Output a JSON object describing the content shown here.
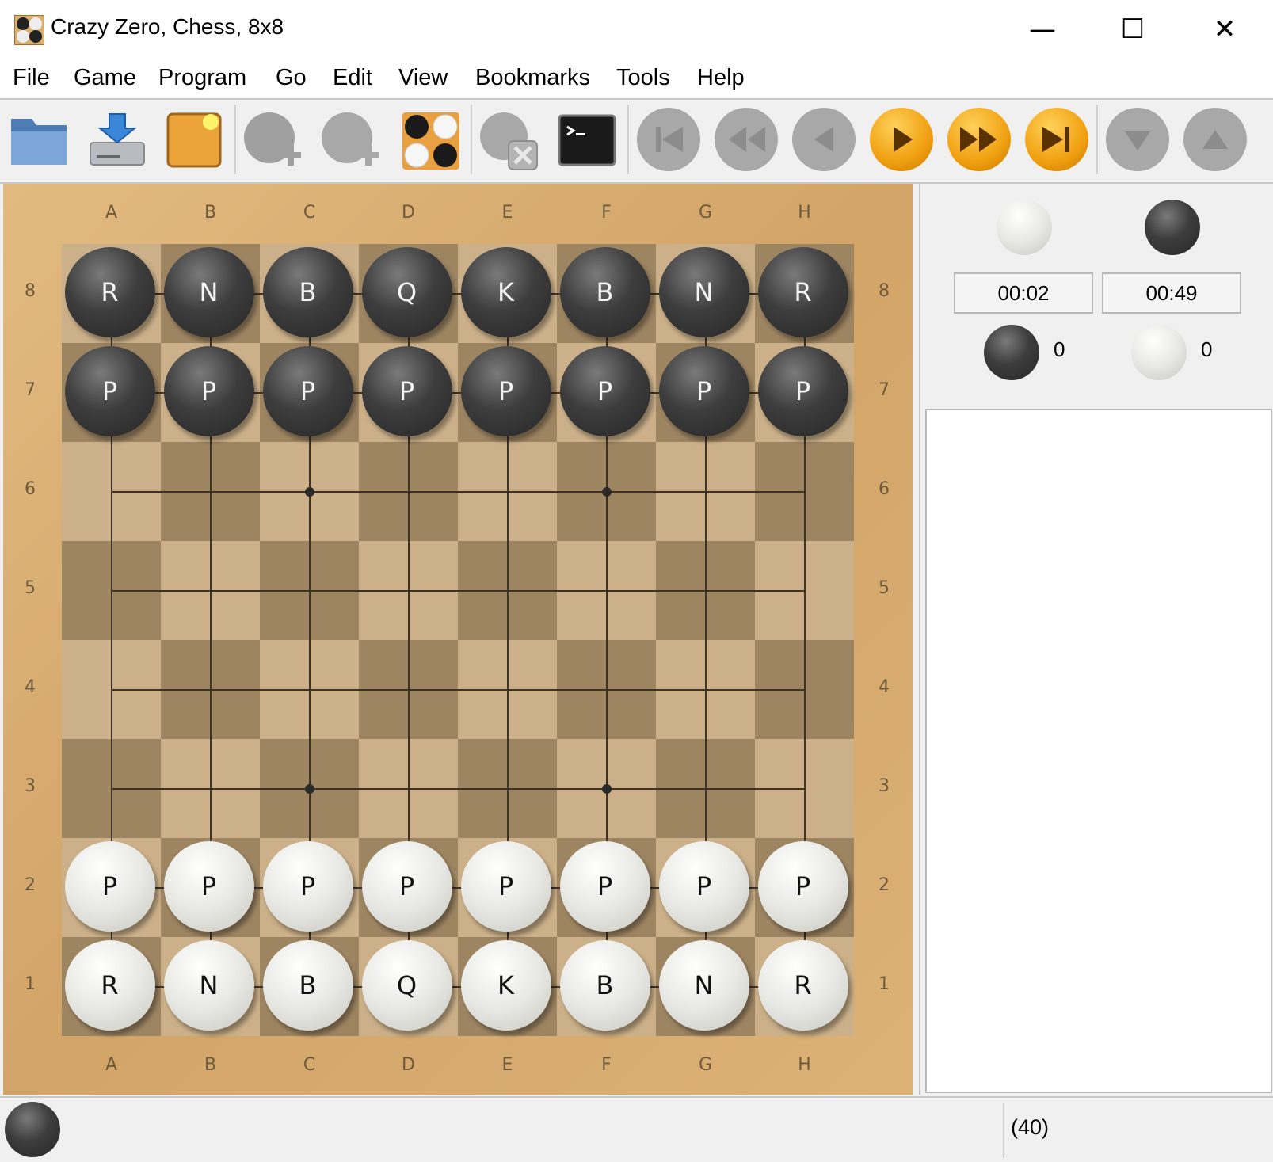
{
  "window": {
    "title": "Crazy Zero, Chess, 8x8",
    "controls": {
      "minimize": "—",
      "maximize": "☐",
      "close": "✕"
    }
  },
  "menu": {
    "items": [
      "File",
      "Game",
      "Program",
      "Go",
      "Edit",
      "View",
      "Bookmarks",
      "Tools",
      "Help"
    ]
  },
  "toolbar": {
    "buttons": [
      {
        "icon": "folder-open-icon",
        "enabled": true
      },
      {
        "icon": "save-icon",
        "enabled": true
      },
      {
        "icon": "new-game-icon",
        "enabled": true
      },
      {
        "icon": "new-program-icon",
        "enabled": false
      },
      {
        "icon": "attach-program-icon",
        "enabled": false
      },
      {
        "icon": "setup-board-icon",
        "enabled": true
      },
      {
        "icon": "detach-program-icon",
        "enabled": false
      },
      {
        "icon": "gtp-shell-icon",
        "enabled": true
      },
      {
        "icon": "beginning-icon",
        "enabled": false
      },
      {
        "icon": "backward-ten-icon",
        "enabled": false
      },
      {
        "icon": "backward-icon",
        "enabled": false
      },
      {
        "icon": "forward-icon",
        "enabled": true
      },
      {
        "icon": "forward-ten-icon",
        "enabled": true
      },
      {
        "icon": "end-icon",
        "enabled": true
      },
      {
        "icon": "next-variation-icon",
        "enabled": false
      },
      {
        "icon": "previous-variation-icon",
        "enabled": false
      }
    ]
  },
  "board": {
    "files": [
      "A",
      "B",
      "C",
      "D",
      "E",
      "F",
      "G",
      "H"
    ],
    "ranks": [
      "8",
      "7",
      "6",
      "5",
      "4",
      "3",
      "2",
      "1"
    ],
    "hoshi": [
      [
        "C",
        "6"
      ],
      [
        "F",
        "6"
      ],
      [
        "C",
        "3"
      ],
      [
        "F",
        "3"
      ]
    ],
    "pieces": [
      {
        "file": "A",
        "rank": "8",
        "color": "black",
        "label": "R"
      },
      {
        "file": "B",
        "rank": "8",
        "color": "black",
        "label": "N"
      },
      {
        "file": "C",
        "rank": "8",
        "color": "black",
        "label": "B"
      },
      {
        "file": "D",
        "rank": "8",
        "color": "black",
        "label": "Q"
      },
      {
        "file": "E",
        "rank": "8",
        "color": "black",
        "label": "K"
      },
      {
        "file": "F",
        "rank": "8",
        "color": "black",
        "label": "B"
      },
      {
        "file": "G",
        "rank": "8",
        "color": "black",
        "label": "N"
      },
      {
        "file": "H",
        "rank": "8",
        "color": "black",
        "label": "R"
      },
      {
        "file": "A",
        "rank": "7",
        "color": "black",
        "label": "P"
      },
      {
        "file": "B",
        "rank": "7",
        "color": "black",
        "label": "P"
      },
      {
        "file": "C",
        "rank": "7",
        "color": "black",
        "label": "P"
      },
      {
        "file": "D",
        "rank": "7",
        "color": "black",
        "label": "P"
      },
      {
        "file": "E",
        "rank": "7",
        "color": "black",
        "label": "P"
      },
      {
        "file": "F",
        "rank": "7",
        "color": "black",
        "label": "P"
      },
      {
        "file": "G",
        "rank": "7",
        "color": "black",
        "label": "P"
      },
      {
        "file": "H",
        "rank": "7",
        "color": "black",
        "label": "P"
      },
      {
        "file": "A",
        "rank": "2",
        "color": "white",
        "label": "P"
      },
      {
        "file": "B",
        "rank": "2",
        "color": "white",
        "label": "P"
      },
      {
        "file": "C",
        "rank": "2",
        "color": "white",
        "label": "P"
      },
      {
        "file": "D",
        "rank": "2",
        "color": "white",
        "label": "P"
      },
      {
        "file": "E",
        "rank": "2",
        "color": "white",
        "label": "P"
      },
      {
        "file": "F",
        "rank": "2",
        "color": "white",
        "label": "P"
      },
      {
        "file": "G",
        "rank": "2",
        "color": "white",
        "label": "P"
      },
      {
        "file": "H",
        "rank": "2",
        "color": "white",
        "label": "P"
      },
      {
        "file": "A",
        "rank": "1",
        "color": "white",
        "label": "R"
      },
      {
        "file": "B",
        "rank": "1",
        "color": "white",
        "label": "N"
      },
      {
        "file": "C",
        "rank": "1",
        "color": "white",
        "label": "B"
      },
      {
        "file": "D",
        "rank": "1",
        "color": "white",
        "label": "Q"
      },
      {
        "file": "E",
        "rank": "1",
        "color": "white",
        "label": "K"
      },
      {
        "file": "F",
        "rank": "1",
        "color": "white",
        "label": "B"
      },
      {
        "file": "G",
        "rank": "1",
        "color": "white",
        "label": "N"
      },
      {
        "file": "H",
        "rank": "1",
        "color": "white",
        "label": "R"
      }
    ]
  },
  "clocks": {
    "white": "00:02",
    "black": "00:49"
  },
  "captures": {
    "black": "0",
    "white": "0"
  },
  "comment": "",
  "status": {
    "to_move": "black",
    "move_info": "(40)"
  }
}
